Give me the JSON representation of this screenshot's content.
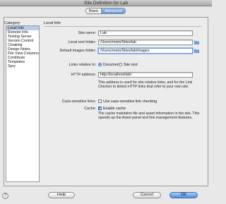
{
  "window": {
    "title": "Site Definition for Lab"
  },
  "tabs": [
    {
      "label": "Basic"
    },
    {
      "label": "Advanced"
    }
  ],
  "category": {
    "label": "Category",
    "items": [
      "Local Info",
      "Remote Info",
      "Testing Server",
      "Version Control",
      "Cloaking",
      "Design Notes",
      "File View Columns",
      "Contribute",
      "Templates",
      "Spry"
    ]
  },
  "panel": {
    "title": "Local Info",
    "site_name": {
      "label": "Site name:",
      "value": "Lab"
    },
    "local_root": {
      "label": "Local root folder:",
      "value": "/Users/rewis/Sites/lab"
    },
    "default_images": {
      "label": "Default images folder:",
      "value": "/Users/rewis/Sites/lab/images"
    },
    "links_relative": {
      "label": "Links relative to:",
      "option_document": "Document",
      "option_site_root": "Site root"
    },
    "http_address": {
      "label": "HTTP address:",
      "value": "http://localhost/lab/"
    },
    "http_note": "This address is used for site relative links, and for the Link Checker to detect HTTP links that refer to your own site.",
    "case_sensitive": {
      "label": "Case-sensitive links:",
      "option": "Use case-sensitive link checking"
    },
    "cache": {
      "label": "Cache:",
      "option": "Enable cache"
    },
    "cache_note": "The cache maintains file and asset information in the site. This speeds up the Asset panel and link management features."
  },
  "buttons": {
    "help": "Help",
    "cancel": "Cancel",
    "ok": "OK",
    "help_icon": "?"
  }
}
